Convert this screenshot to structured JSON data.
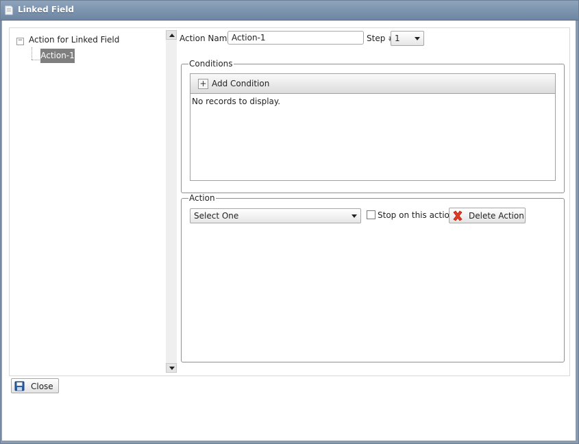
{
  "window": {
    "title": "Linked Field",
    "title_icon": "document-icon"
  },
  "tree": {
    "root_label": "Action for Linked Field",
    "child_label": "Action-1"
  },
  "form": {
    "action_name_label": "Action Name",
    "action_name_value": "Action-1",
    "step_label": "Step #",
    "step_value": "1"
  },
  "conditions": {
    "legend": "Conditions",
    "add_label": "Add Condition",
    "empty_text": "No records to display."
  },
  "action": {
    "legend": "Action",
    "select_value": "Select One",
    "stop_label": "Stop on this action",
    "stop_checked": false,
    "delete_label": "Delete Action"
  },
  "footer": {
    "close_label": "Close"
  }
}
